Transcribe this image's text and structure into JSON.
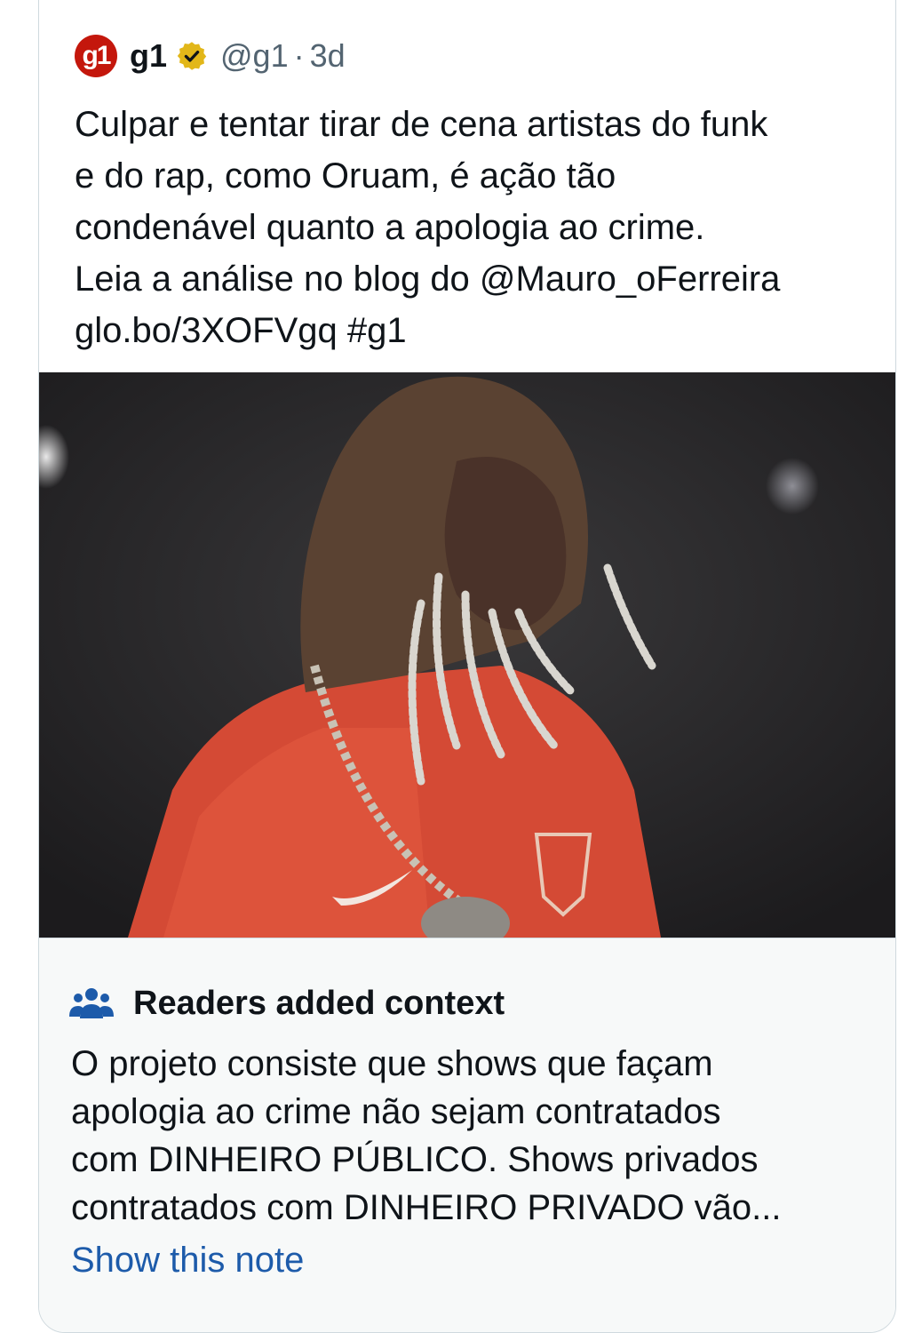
{
  "tweet": {
    "avatar_text": "g1",
    "name": "g1",
    "handle": "@g1",
    "separator": "·",
    "time": "3d",
    "text_lines": [
      "Culpar e tentar tirar de cena artistas do funk",
      "e do rap, como Oruam, é ação tão",
      "condenável quanto a apologia ao crime.",
      "Leia a análise no blog do @Mauro_oFerreira",
      "glo.bo/3XOFVgq #g1"
    ]
  },
  "note": {
    "icon": "readers-icon",
    "title": "Readers added context",
    "body_lines": [
      "O projeto consiste que shows que façam",
      "apologia ao crime não sejam contratados",
      "com DINHEIRO PÚBLICO. Shows privados",
      "contratados com DINHEIRO PRIVADO vão..."
    ],
    "show_label": "Show this note"
  },
  "colors": {
    "brand_red": "#c4170c",
    "verified_gold": "#e2b719",
    "link_blue": "#1d5baa",
    "note_icon_blue": "#1d5baa",
    "secondary_text": "#536471"
  }
}
